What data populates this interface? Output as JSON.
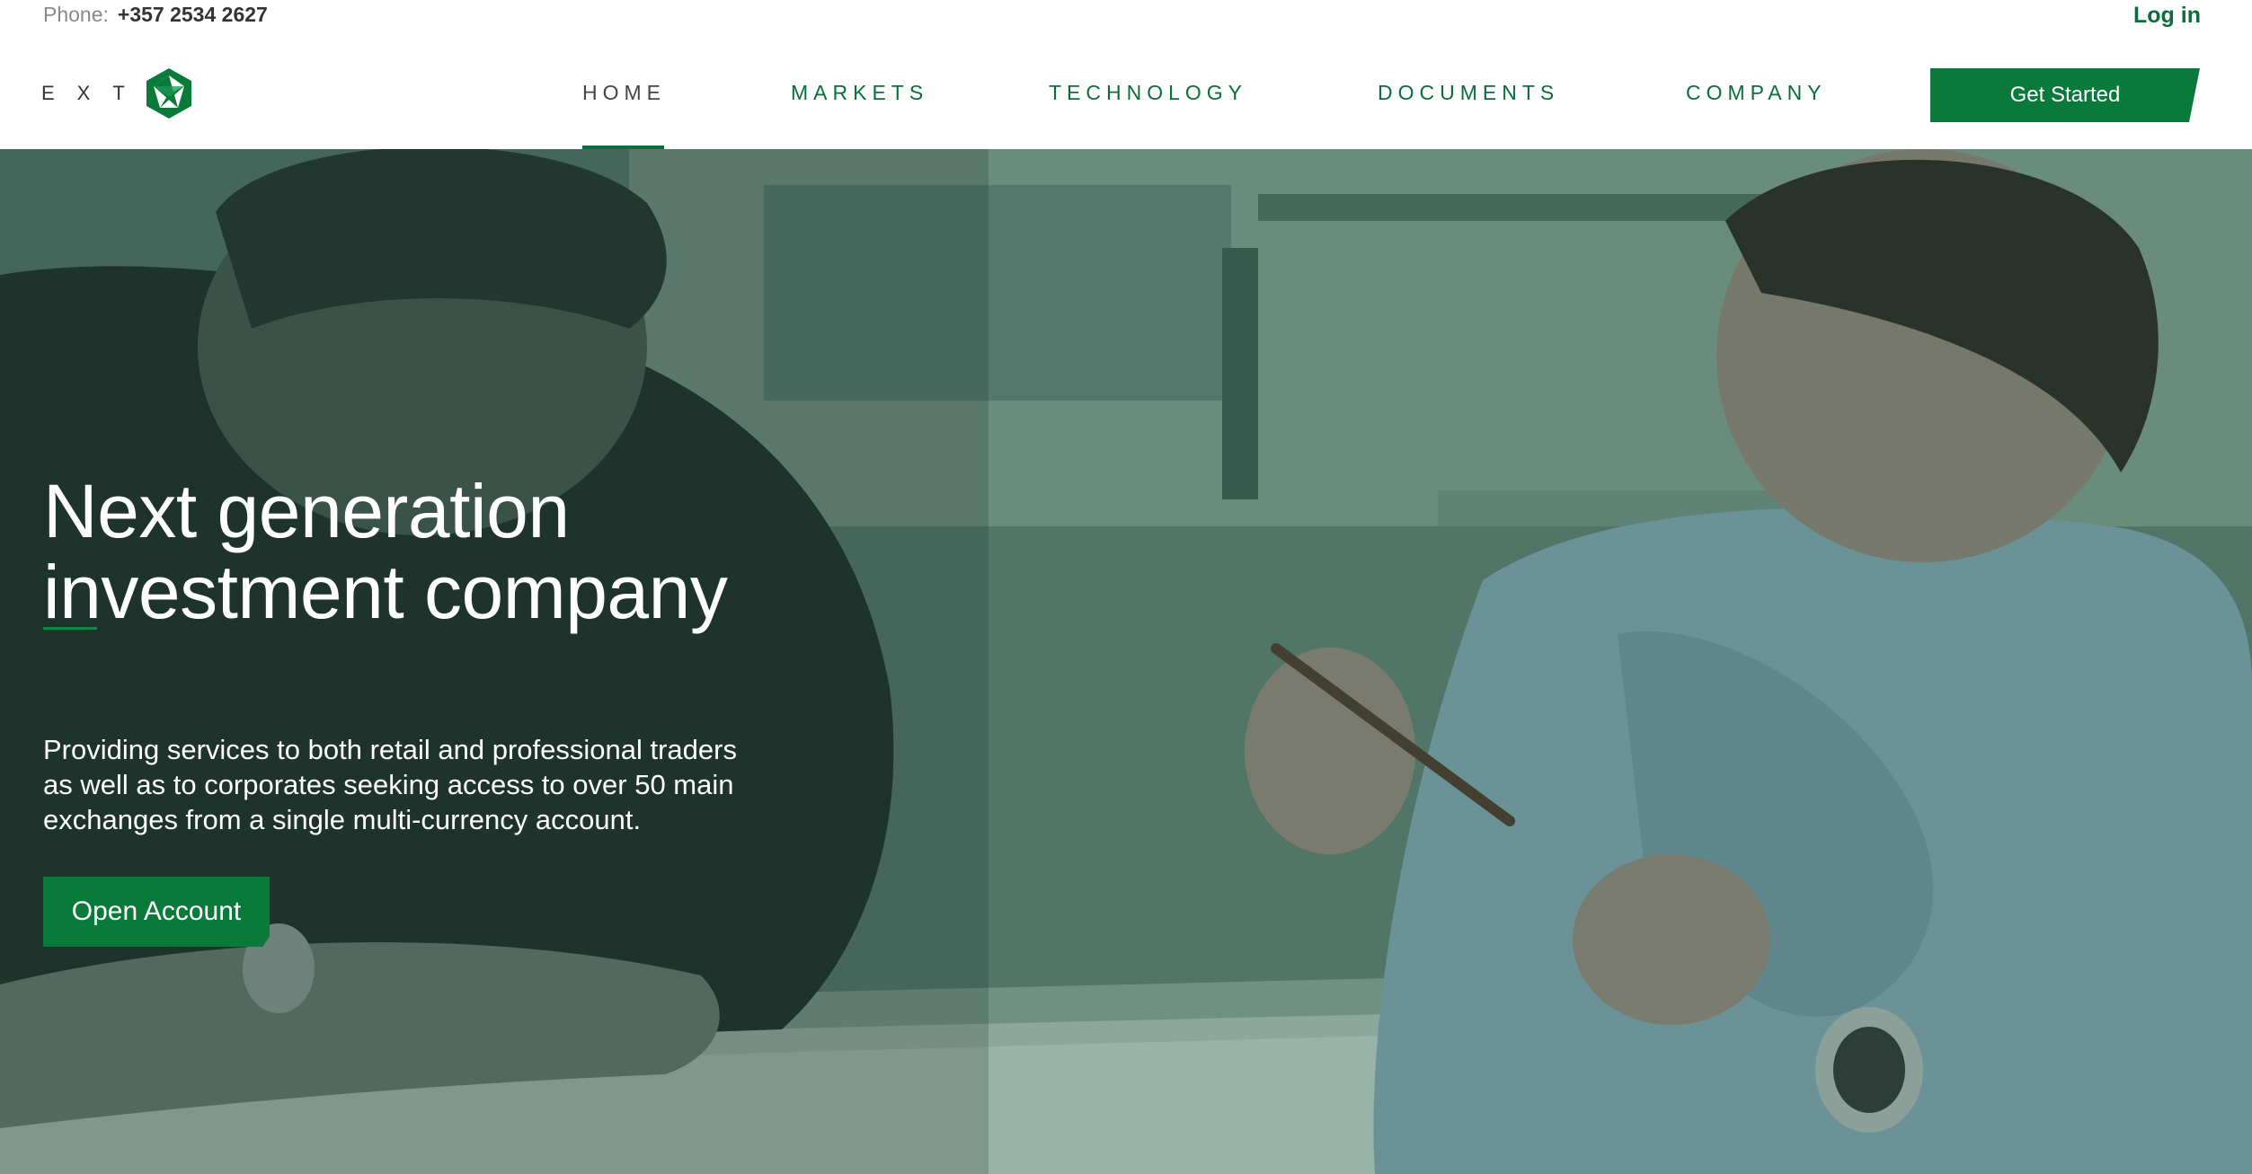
{
  "topbar": {
    "phone_label": "Phone:",
    "phone_number": "+357 2534 2627",
    "login_label": "Log in"
  },
  "header": {
    "logo_text": "EXT",
    "nav": [
      {
        "label": "HOME",
        "active": true
      },
      {
        "label": "MARKETS",
        "active": false
      },
      {
        "label": "TECHNOLOGY",
        "active": false
      },
      {
        "label": "DOCUMENTS",
        "active": false
      },
      {
        "label": "COMPANY",
        "active": false
      }
    ],
    "cta_label": "Get Started"
  },
  "hero": {
    "title_line1": "Next generation",
    "title_line2": "investment company",
    "description": "Providing services to both retail and professional traders as well as to corporates seeking access to over 50 main exchanges from a single multi-currency account.",
    "button_label": "Open Account"
  },
  "colors": {
    "brand_green": "#0a7a3a",
    "nav_green": "#0a6e3b",
    "hero_overlay": "#4a6b5e"
  }
}
